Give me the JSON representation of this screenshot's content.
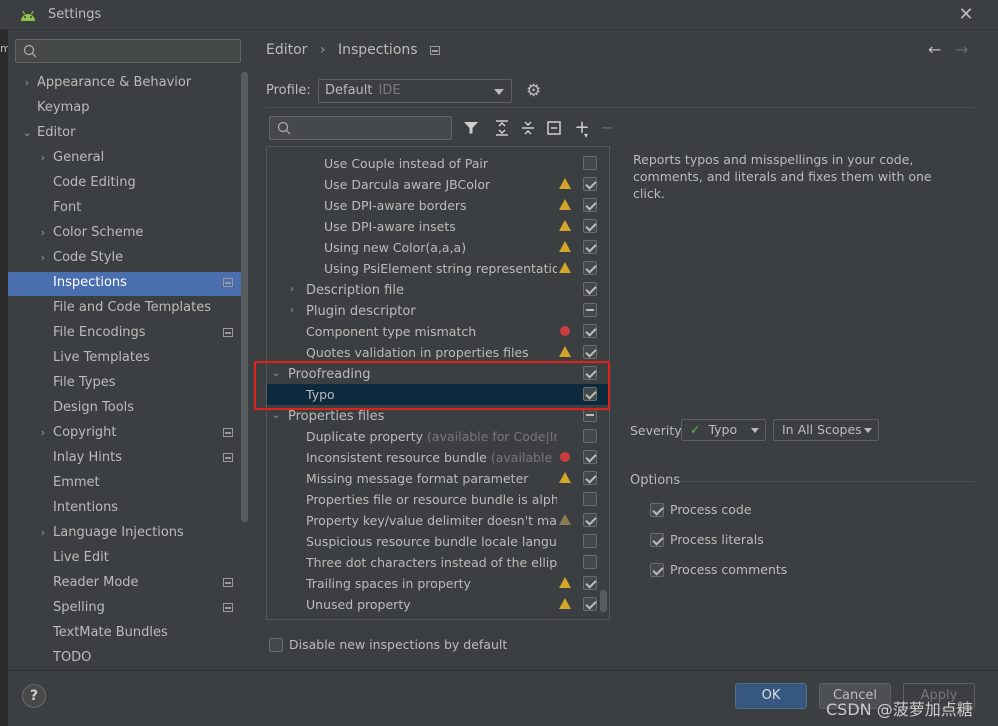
{
  "window": {
    "title": "Settings",
    "close_icon": "close-icon"
  },
  "sidebar": {
    "search_placeholder": "",
    "items": [
      {
        "label": "Appearance & Behavior",
        "arrow": "›"
      },
      {
        "label": "Keymap"
      },
      {
        "label": "Editor",
        "arrow": "⌄"
      },
      {
        "label": "General",
        "arrow": "›"
      },
      {
        "label": "Code Editing"
      },
      {
        "label": "Font"
      },
      {
        "label": "Color Scheme",
        "arrow": "›"
      },
      {
        "label": "Code Style",
        "arrow": "›"
      },
      {
        "label": "Inspections"
      },
      {
        "label": "File and Code Templates"
      },
      {
        "label": "File Encodings"
      },
      {
        "label": "Live Templates"
      },
      {
        "label": "File Types"
      },
      {
        "label": "Design Tools"
      },
      {
        "label": "Copyright",
        "arrow": "›"
      },
      {
        "label": "Inlay Hints"
      },
      {
        "label": "Emmet"
      },
      {
        "label": "Intentions"
      },
      {
        "label": "Language Injections",
        "arrow": "›"
      },
      {
        "label": "Live Edit"
      },
      {
        "label": "Reader Mode"
      },
      {
        "label": "Spelling"
      },
      {
        "label": "TextMate Bundles"
      },
      {
        "label": "TODO"
      }
    ]
  },
  "header": {
    "crumb1": "Editor",
    "sep": "›",
    "crumb2": "Inspections",
    "back": "←",
    "forward": "→"
  },
  "profile": {
    "label": "Profile:",
    "value": "Default",
    "scope": "IDE"
  },
  "toolbar": {
    "filter": "filter-icon",
    "expand": "expand-all-icon",
    "collapse": "collapse-all-icon",
    "reset": "reset-icon",
    "add": "+",
    "remove": "−"
  },
  "tree": [
    {
      "label": "Use Couple instead of Pair"
    },
    {
      "label": "Use Darcula aware JBColor"
    },
    {
      "label": "Use DPI-aware borders"
    },
    {
      "label": "Use DPI-aware insets"
    },
    {
      "label": "Using new Color(a,a,a)"
    },
    {
      "label": "Using PsiElement string representation to"
    },
    {
      "label": "Description file"
    },
    {
      "label": "Plugin descriptor"
    },
    {
      "label": "Component type mismatch"
    },
    {
      "label": "Quotes validation in properties files"
    },
    {
      "label": "Proofreading"
    },
    {
      "label": "Typo"
    },
    {
      "label": "Properties files"
    },
    {
      "label": "Duplicate property",
      "note": "(available for Code|Inspe"
    },
    {
      "label": "Inconsistent resource bundle",
      "note": "(available for C"
    },
    {
      "label": "Missing message format parameter"
    },
    {
      "label": "Properties file or resource bundle is alphabet"
    },
    {
      "label": "Property key/value delimiter doesn't match c"
    },
    {
      "label": "Suspicious resource bundle locale languages"
    },
    {
      "label": "Three dot characters instead of the ellipsis"
    },
    {
      "label": "Trailing spaces in property"
    },
    {
      "label": "Unused property"
    }
  ],
  "description": "Reports typos and misspellings in your code, comments, and literals and fixes them with one click.",
  "severity": {
    "label": "Severity:",
    "value": "Typo",
    "scope": "In All Scopes"
  },
  "options": {
    "title": "Options",
    "items": [
      "Process code",
      "Process literals",
      "Process comments"
    ]
  },
  "disable_new": "Disable new inspections by default",
  "buttons": {
    "help": "?",
    "ok": "OK",
    "cancel": "Cancel",
    "apply": "Apply"
  },
  "watermark": "CSDN @菠萝加点糖"
}
